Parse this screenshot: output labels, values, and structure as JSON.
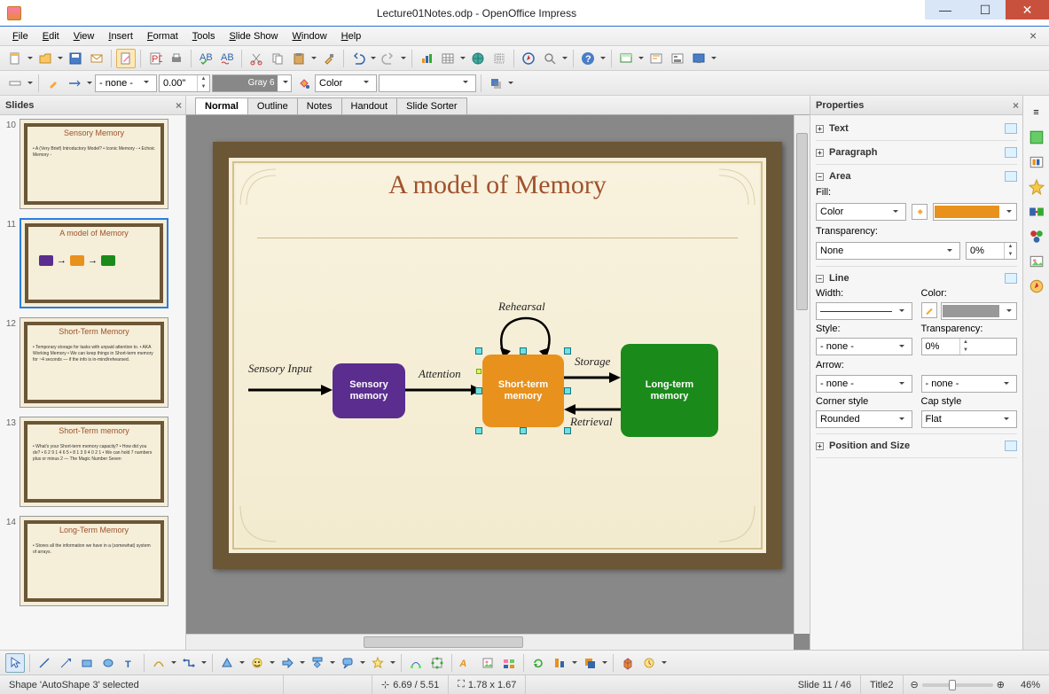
{
  "window": {
    "title": "Lecture01Notes.odp - OpenOffice Impress"
  },
  "menu": [
    "File",
    "Edit",
    "View",
    "Insert",
    "Format",
    "Tools",
    "Slide Show",
    "Window",
    "Help"
  ],
  "toolbar_line_controls": {
    "style": "- none -",
    "width": "0.00\"",
    "color_label": "Gray 6",
    "fill_mode": "Color"
  },
  "slides_panel": {
    "title": "Slides"
  },
  "slides": [
    {
      "num": "10",
      "title": "Sensory Memory",
      "body": "• A (Very Brief) Introductory Model?\n• Iconic Memory -\n• Echoic Memory -"
    },
    {
      "num": "11",
      "title": "A model of Memory",
      "diagram": true,
      "selected": true
    },
    {
      "num": "12",
      "title": "Short-Term Memory",
      "body": "• Temporary storage for tasks with unpaid attention to.\n• AKA Working Memory\n• We can keep things in Short-term memory for ~4 seconds — if the info is in-mind/rehearsed."
    },
    {
      "num": "13",
      "title": "Short-Term memory",
      "body": "• What's your Short-term memory capacity?\n• How did you do?\n  • 6 2 9 1 4 6 5\n  • 8 1 3 9 4 0 2 1\n• We can hold 7 numbers plus or minus 2 — The Magic Number Seven"
    },
    {
      "num": "14",
      "title": "Long-Term Memory",
      "body": "• Stores all the information we have in a (somewhat) system of arrays."
    }
  ],
  "view_tabs": [
    "Normal",
    "Outline",
    "Notes",
    "Handout",
    "Slide Sorter"
  ],
  "slide": {
    "title": "A model of Memory",
    "labels": {
      "sensory_input": "Sensory Input",
      "attention": "Attention",
      "rehearsal": "Rehearsal",
      "storage": "Storage",
      "retrieval": "Retrieval"
    },
    "boxes": {
      "sensory": "Sensory\nmemory",
      "short": "Short-term\nmemory",
      "long": "Long-term\nmemory"
    }
  },
  "properties": {
    "title": "Properties",
    "groups": {
      "text": "Text",
      "paragraph": "Paragraph",
      "area": "Area",
      "line": "Line",
      "pos_size": "Position and Size"
    },
    "area": {
      "fill_label": "Fill:",
      "fill_mode": "Color",
      "fill_color": "#e8911c",
      "transparency_label": "Transparency:",
      "transparency_mode": "None",
      "transparency_value": "0%"
    },
    "line": {
      "width_label": "Width:",
      "color_label": "Color:",
      "style_label": "Style:",
      "style_value": "- none -",
      "transparency_label": "Transparency:",
      "transparency_value": "0%",
      "arrow_label": "Arrow:",
      "arrow_start": "- none -",
      "arrow_end": "- none -",
      "corner_label": "Corner style",
      "corner_value": "Rounded",
      "cap_label": "Cap style",
      "cap_value": "Flat"
    }
  },
  "status": {
    "selection": "Shape 'AutoShape 3' selected",
    "pos": "6.69 / 5.51",
    "size": "1.78 x 1.67",
    "slide": "Slide 11 / 46",
    "master": "Title2",
    "zoom": "46%"
  }
}
